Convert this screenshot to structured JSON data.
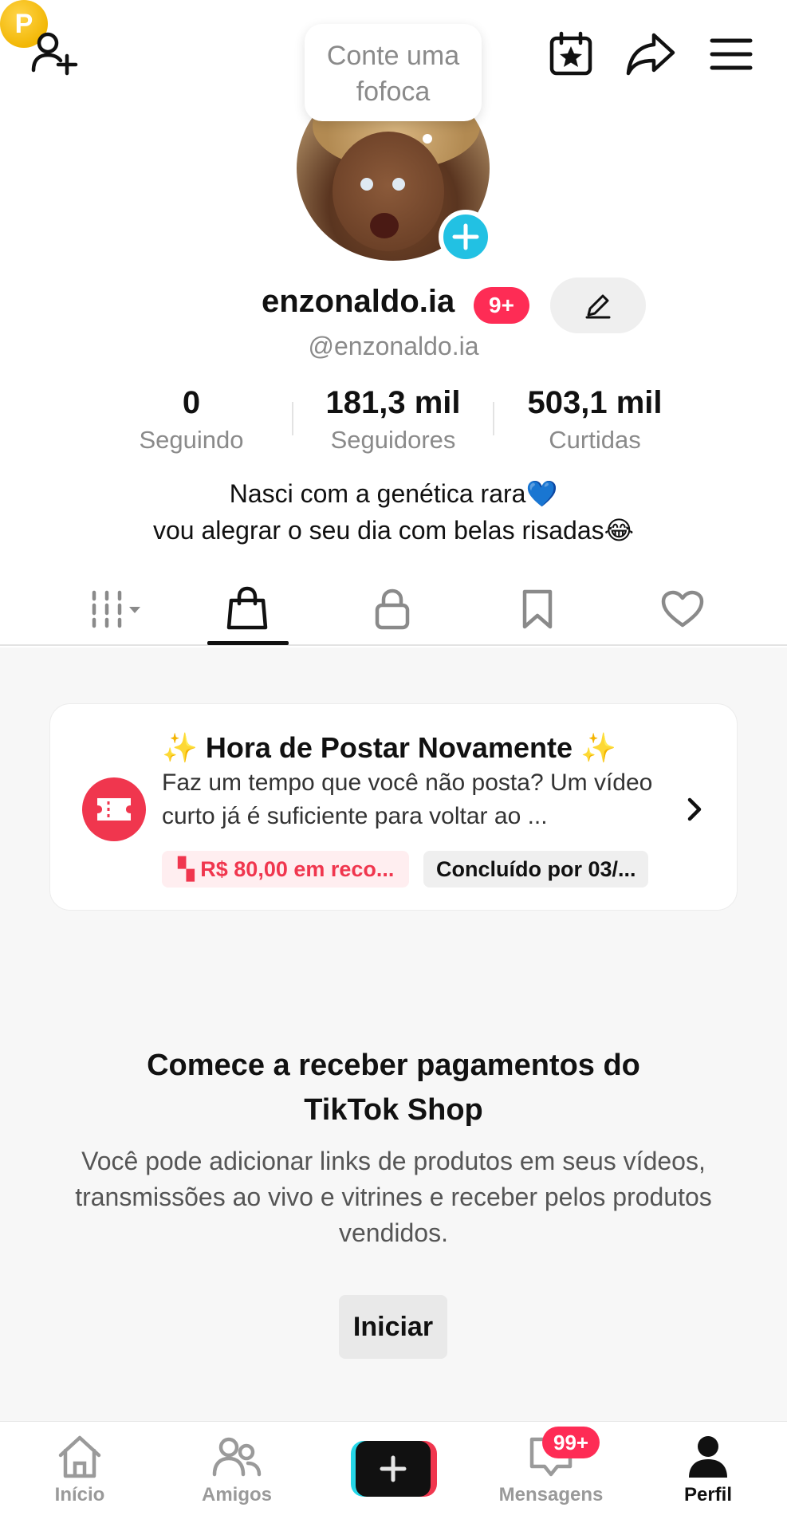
{
  "header": {
    "coin_letter": "P",
    "bubble_text": "Conte uma fofoca",
    "icons": [
      "add-friend-icon",
      "coin-icon",
      "calendar-star-icon",
      "share-icon",
      "menu-icon"
    ]
  },
  "profile": {
    "display_name": "enzonaldo.ia",
    "badge": "9+",
    "handle": "@enzonaldo.ia",
    "stats": [
      {
        "value": "0",
        "label": "Seguindo"
      },
      {
        "value": "181,3 mil",
        "label": "Seguidores"
      },
      {
        "value": "503,1 mil",
        "label": "Curtidas"
      }
    ],
    "bio_line1": "Nasci com a genética rara💙",
    "bio_line2": "vou alegrar o seu dia com belas risadas😂"
  },
  "tabs": [
    {
      "name": "videos-grid",
      "icon": "grid-icon"
    },
    {
      "name": "shop",
      "icon": "shopping-bag-icon",
      "active": true
    },
    {
      "name": "private",
      "icon": "lock-icon"
    },
    {
      "name": "saved",
      "icon": "bookmark-icon"
    },
    {
      "name": "liked",
      "icon": "heart-icon"
    }
  ],
  "task_card": {
    "title": "✨ Hora de Postar Novamente ✨",
    "text": "Faz um tempo que você não posta? Um vídeo curto já é suficiente para voltar ao ...",
    "reward": "R$ 80,00 em reco...",
    "deadline": "Concluído por 03/..."
  },
  "shop": {
    "title_line1": "Comece a receber pagamentos do",
    "title_line2": "TikTok Shop",
    "desc": "Você pode adicionar links de produtos em seus vídeos, transmissões ao vivo e vitrines e receber pelos produtos vendidos.",
    "start_label": "Iniciar"
  },
  "bottom_nav": {
    "home": "Início",
    "friends": "Amigos",
    "messages": "Mensagens",
    "messages_badge": "99+",
    "profile": "Perfil"
  },
  "colors": {
    "accent_red": "#fe2c55",
    "accent_cyan": "#22c1e3",
    "coin_gold": "#f2b705"
  }
}
